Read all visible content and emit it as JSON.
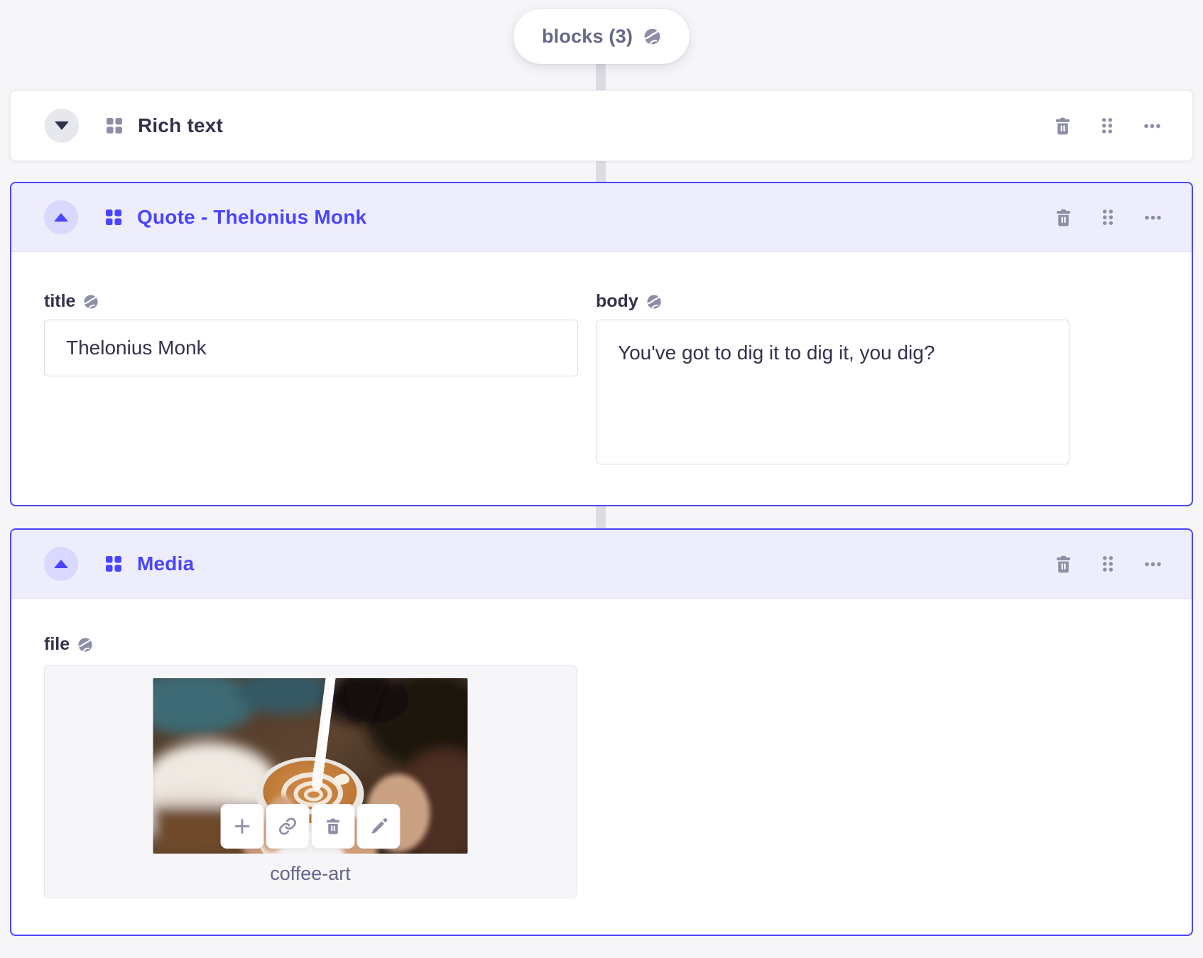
{
  "colors": {
    "primary": "#4945ff",
    "primary_header_bg": "#eeedfc",
    "primary_toggle_bg": "#d9d8ff",
    "page_bg": "#f6f6f9",
    "card_bg": "#ffffff",
    "card_border": "#eaeaef",
    "input_border": "#dcdce4",
    "text_dark": "#32324d",
    "text_muted": "#666687",
    "icon_muted": "#8e8ea9",
    "connector": "#dcdce4"
  },
  "icons": {
    "localized": "globe-icon",
    "block": "blocks-grid-icon",
    "delete": "trash-icon",
    "drag": "drag-handle-icon",
    "more": "more-options-icon",
    "collapse": "caret-up-icon",
    "expand": "caret-down-icon",
    "media_actions": [
      "plus-icon",
      "link-icon",
      "trash-icon",
      "pencil-icon"
    ]
  },
  "array_field": {
    "label": "blocks (3)"
  },
  "blocks": [
    {
      "title": "Rich text",
      "state": "collapsed"
    },
    {
      "title": "Quote - Thelonius Monk",
      "state": "expanded",
      "fields": {
        "title": {
          "label": "title",
          "value": "Thelonius Monk"
        },
        "body": {
          "label": "body",
          "value": "You've got to dig it to dig it, you dig?"
        }
      }
    },
    {
      "title": "Media",
      "state": "expanded",
      "fields": {
        "file": {
          "label": "file",
          "file_name": "coffee-art"
        }
      }
    }
  ]
}
